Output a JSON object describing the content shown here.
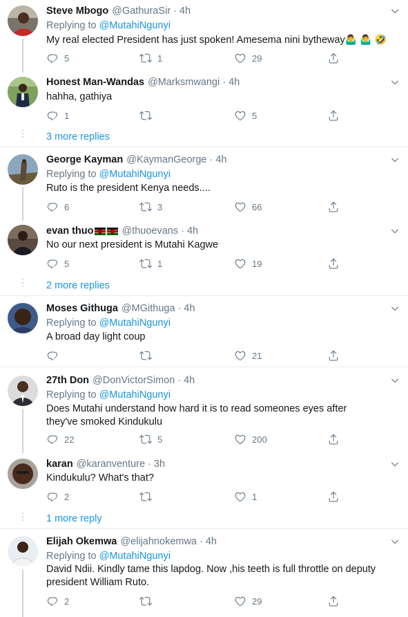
{
  "replying_label": "Replying to",
  "tweets": [
    {
      "name": "Steve Mbogo",
      "handle": "@GathuraSir",
      "dot": "·",
      "time": "4h",
      "replying_to": "@MutahiNgunyi",
      "text": "My real elected President has just spoken! Amesema nini bytheway",
      "emojis": "🤷‍♂️ 🤷‍♂️ 🤣",
      "replies": "5",
      "retweets": "1",
      "likes": "29"
    },
    {
      "name": "Honest Man-Wandas",
      "handle": "@Marksmwangi",
      "dot": "·",
      "time": "4h",
      "text": "hahha, gathiya",
      "replies": "1",
      "retweets": "",
      "likes": "5"
    },
    {
      "name": "George Kayman",
      "handle": "@KaymanGeorge",
      "dot": "·",
      "time": "4h",
      "replying_to": "@MutahiNgunyi",
      "text": "Ruto is the president Kenya needs....",
      "replies": "6",
      "retweets": "3",
      "likes": "66"
    },
    {
      "name": "evan thuo",
      "handle": "@thuoevans",
      "dot": "·",
      "time": "4h",
      "text": "No our next president is Mutahi Kagwe",
      "replies": "5",
      "retweets": "1",
      "likes": "19"
    },
    {
      "name": "Moses Githuga",
      "handle": "@MGithuga",
      "dot": "·",
      "time": "4h",
      "replying_to": "@MutahiNgunyi",
      "text": "A broad day light coup",
      "replies": "",
      "retweets": "",
      "likes": "21"
    },
    {
      "name": "27th Don",
      "handle": "@DonVictorSimon",
      "dot": "·",
      "time": "4h",
      "replying_to": "@MutahiNgunyi",
      "text": "Does Mutahi understand how hard it is to read someones eyes after they've smoked Kindukulu",
      "replies": "22",
      "retweets": "5",
      "likes": "200"
    },
    {
      "name": "karan",
      "handle": "@karanventure",
      "dot": "·",
      "time": "3h",
      "text": "Kindukulu? What's that?",
      "replies": "2",
      "retweets": "",
      "likes": "1"
    },
    {
      "name": "Elijah Okemwa",
      "handle": "@elijahnokemwa",
      "dot": "·",
      "time": "4h",
      "replying_to": "@MutahiNgunyi",
      "text": "David Ndii. Kindly tame this lapdog. Now ,his teeth is full throttle on deputy president William Ruto.",
      "replies": "2",
      "retweets": "",
      "likes": "29"
    }
  ],
  "more_replies": {
    "a": "3 more replies",
    "b": "2 more replies",
    "c": "1 more reply"
  },
  "colors": {
    "link": "#1b95e0",
    "secondary": "#657786",
    "border": "#e6ecf0",
    "thread": "#ccd6dd"
  },
  "icons": [
    "reply-icon",
    "retweet-icon",
    "like-icon",
    "share-icon",
    "caret-down-icon",
    "kenya-flag-icon"
  ]
}
